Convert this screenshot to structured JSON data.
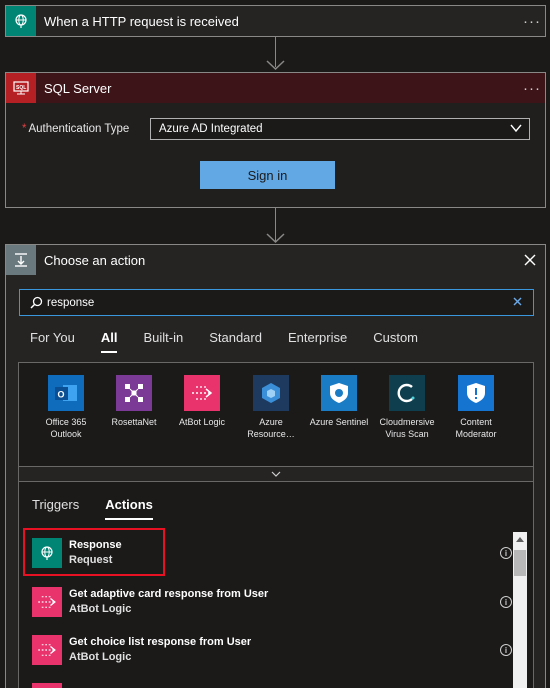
{
  "http_card": {
    "title": "When a HTTP request is received",
    "more_icon": "ellipsis-icon",
    "more": "···"
  },
  "sql_card": {
    "title": "SQL Server",
    "more": "···",
    "auth_label": "Authentication Type",
    "auth_required_mark": "*",
    "auth_value": "Azure AD Integrated",
    "sign_in_label": "Sign in"
  },
  "action_card": {
    "title": "Choose an action",
    "search_value": "response",
    "tabs": [
      "For You",
      "All",
      "Built-in",
      "Standard",
      "Enterprise",
      "Custom"
    ],
    "active_tab": "All",
    "connectors": [
      {
        "name": "Office 365 Outlook",
        "color": "#0f6cbd",
        "icon": "outlook-icon"
      },
      {
        "name": "RosettaNet",
        "color": "#7b3a96",
        "icon": "rosettanet-icon"
      },
      {
        "name": "AtBot Logic",
        "color": "#e8336d",
        "icon": "atbot-icon"
      },
      {
        "name": "Azure Resource…",
        "color": "#1e3a5f",
        "icon": "azure-resource-icon"
      },
      {
        "name": "Azure Sentinel",
        "color": "#1a7cc4",
        "icon": "sentinel-icon"
      },
      {
        "name": "Cloudmersive Virus Scan",
        "color": "#0f3f4f",
        "icon": "cloudmersive-icon"
      },
      {
        "name": "Content Moderator",
        "color": "#1674d1",
        "icon": "shield-icon"
      }
    ],
    "subtabs": [
      "Triggers",
      "Actions"
    ],
    "active_subtab": "Actions",
    "actions": [
      {
        "name": "Response",
        "connector": "Request",
        "color": "#008575",
        "icon": "globe-icon"
      },
      {
        "name": "Get adaptive card response from User",
        "connector": "AtBot Logic",
        "color": "#e8336d",
        "icon": "atbot-icon"
      },
      {
        "name": "Get choice list response from User",
        "connector": "AtBot Logic",
        "color": "#e8336d",
        "icon": "atbot-icon"
      },
      {
        "name": "",
        "connector": "",
        "color": "#e8336d",
        "icon": "atbot-icon"
      }
    ]
  }
}
